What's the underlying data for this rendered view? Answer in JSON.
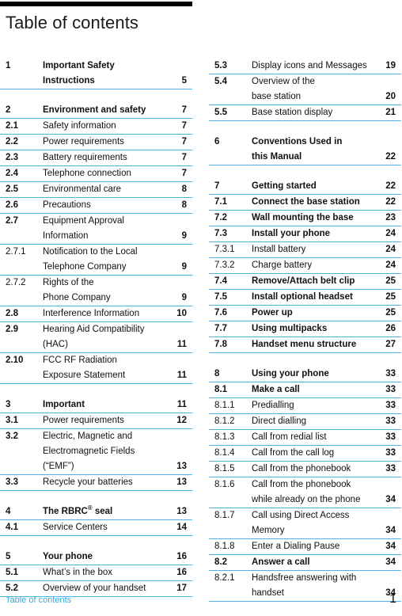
{
  "document": {
    "title": "Table of contents",
    "footer_label": "Table of contents",
    "footer_page": "1",
    "rule_color": "#4FB3E8",
    "accent_color": "#36A9E1",
    "bar_color": "#000000"
  },
  "columns": [
    {
      "groups": [
        {
          "rows": [
            {
              "num": "1",
              "lines": [
                "Important Safety",
                "Instructions"
              ],
              "page": "5",
              "level": 1,
              "bold_num": true,
              "bold_title": true,
              "bold_page": true
            }
          ]
        },
        {
          "rows": [
            {
              "num": "2",
              "lines": [
                "Environment and safety"
              ],
              "page": "7",
              "level": 1,
              "bold_num": true,
              "bold_title": true,
              "bold_page": true
            },
            {
              "num": "2.1",
              "lines": [
                "Safety information"
              ],
              "page": "7",
              "level": 2,
              "bold_num": true,
              "bold_title": false,
              "bold_page": true
            },
            {
              "num": "2.2",
              "lines": [
                "Power requirements"
              ],
              "page": "7",
              "level": 2,
              "bold_num": true,
              "bold_title": false,
              "bold_page": true
            },
            {
              "num": "2.3",
              "lines": [
                "Battery requirements"
              ],
              "page": "7",
              "level": 2,
              "bold_num": true,
              "bold_title": false,
              "bold_page": true
            },
            {
              "num": "2.4",
              "lines": [
                "Telephone connection"
              ],
              "page": "7",
              "level": 2,
              "bold_num": true,
              "bold_title": false,
              "bold_page": true
            },
            {
              "num": "2.5",
              "lines": [
                "Environmental care"
              ],
              "page": "8",
              "level": 2,
              "bold_num": true,
              "bold_title": false,
              "bold_page": true
            },
            {
              "num": "2.6",
              "lines": [
                "Precautions"
              ],
              "page": "8",
              "level": 2,
              "bold_num": true,
              "bold_title": false,
              "bold_page": true
            },
            {
              "num": "2.7",
              "lines": [
                "Equipment Approval",
                "Information"
              ],
              "page": "9",
              "level": 2,
              "bold_num": true,
              "bold_title": false,
              "bold_page": true
            },
            {
              "num": "2.7.1",
              "lines": [
                "Notification to the Local",
                "Telephone Company"
              ],
              "page": "9",
              "level": 3,
              "bold_num": false,
              "bold_title": false,
              "bold_page": true
            },
            {
              "num": "2.7.2",
              "lines": [
                "Rights of the",
                "Phone Company"
              ],
              "page": "9",
              "level": 3,
              "bold_num": false,
              "bold_title": false,
              "bold_page": true
            },
            {
              "num": "2.8",
              "lines": [
                "Interference Information"
              ],
              "page": "10",
              "level": 2,
              "bold_num": true,
              "bold_title": false,
              "bold_page": true
            },
            {
              "num": "2.9",
              "lines": [
                "Hearing Aid Compatibility",
                "(HAC)"
              ],
              "page": "11",
              "level": 2,
              "bold_num": true,
              "bold_title": false,
              "bold_page": true
            },
            {
              "num": "2.10",
              "lines": [
                "FCC RF Radiation",
                "Exposure Statement"
              ],
              "page": "11",
              "level": 2,
              "bold_num": true,
              "bold_title": false,
              "bold_page": true
            }
          ]
        },
        {
          "rows": [
            {
              "num": "3",
              "lines": [
                "Important"
              ],
              "page": "11",
              "level": 1,
              "bold_num": true,
              "bold_title": true,
              "bold_page": true
            },
            {
              "num": "3.1",
              "lines": [
                "Power requirements"
              ],
              "page": "12",
              "level": 2,
              "bold_num": true,
              "bold_title": false,
              "bold_page": true
            },
            {
              "num": "3.2",
              "lines": [
                "Electric, Magnetic and",
                "Electromagnetic Fields",
                "(“EMF”)"
              ],
              "page": "13",
              "level": 2,
              "bold_num": true,
              "bold_title": false,
              "bold_page": true
            },
            {
              "num": "3.3",
              "lines": [
                "Recycle your batteries"
              ],
              "page": "13",
              "level": 2,
              "bold_num": true,
              "bold_title": false,
              "bold_page": true
            }
          ]
        },
        {
          "rows": [
            {
              "num": "4",
              "lines": [
                "The RBRC® seal"
              ],
              "page": "13",
              "level": 1,
              "bold_num": true,
              "bold_title": true,
              "bold_page": true,
              "html_title": true
            },
            {
              "num": "4.1",
              "lines": [
                "Service Centers"
              ],
              "page": "14",
              "level": 2,
              "bold_num": true,
              "bold_title": false,
              "bold_page": true
            }
          ]
        },
        {
          "rows": [
            {
              "num": "5",
              "lines": [
                "Your phone"
              ],
              "page": "16",
              "level": 1,
              "bold_num": true,
              "bold_title": true,
              "bold_page": true
            },
            {
              "num": "5.1",
              "lines": [
                "What’s in the box"
              ],
              "page": "16",
              "level": 2,
              "bold_num": true,
              "bold_title": false,
              "bold_page": true
            },
            {
              "num": "5.2",
              "lines": [
                "Overview of your handset"
              ],
              "page": "17",
              "level": 2,
              "bold_num": true,
              "bold_title": false,
              "bold_page": true
            }
          ]
        }
      ]
    },
    {
      "groups": [
        {
          "rows": [
            {
              "num": "5.3",
              "lines": [
                "Display icons and Messages"
              ],
              "page": "19",
              "level": 2,
              "bold_num": true,
              "bold_title": false,
              "bold_page": true
            },
            {
              "num": "5.4",
              "lines": [
                "Overview of the",
                "base station"
              ],
              "page": "20",
              "level": 2,
              "bold_num": true,
              "bold_title": false,
              "bold_page": true
            },
            {
              "num": "5.5",
              "lines": [
                "Base station display"
              ],
              "page": "21",
              "level": 2,
              "bold_num": true,
              "bold_title": false,
              "bold_page": true
            }
          ]
        },
        {
          "rows": [
            {
              "num": "6",
              "lines": [
                "Conventions Used in",
                "this Manual"
              ],
              "page": "22",
              "level": 1,
              "bold_num": true,
              "bold_title": true,
              "bold_page": true
            }
          ]
        },
        {
          "rows": [
            {
              "num": "7",
              "lines": [
                "Getting started"
              ],
              "page": "22",
              "level": 1,
              "bold_num": true,
              "bold_title": true,
              "bold_page": true
            },
            {
              "num": "7.1",
              "lines": [
                "Connect the base station"
              ],
              "page": "22",
              "level": 2,
              "bold_num": true,
              "bold_title": true,
              "bold_page": true
            },
            {
              "num": "7.2",
              "lines": [
                "Wall mounting the base"
              ],
              "page": "23",
              "level": 2,
              "bold_num": true,
              "bold_title": true,
              "bold_page": true
            },
            {
              "num": "7.3",
              "lines": [
                "Install your phone"
              ],
              "page": "24",
              "level": 2,
              "bold_num": true,
              "bold_title": true,
              "bold_page": true
            },
            {
              "num": "7.3.1",
              "lines": [
                "Install battery"
              ],
              "page": "24",
              "level": 3,
              "bold_num": false,
              "bold_title": false,
              "bold_page": true
            },
            {
              "num": "7.3.2",
              "lines": [
                "Charge battery"
              ],
              "page": "24",
              "level": 3,
              "bold_num": false,
              "bold_title": false,
              "bold_page": true
            },
            {
              "num": "7.4",
              "lines": [
                "Remove/Attach belt clip"
              ],
              "page": "25",
              "level": 2,
              "bold_num": true,
              "bold_title": true,
              "bold_page": true
            },
            {
              "num": "7.5",
              "lines": [
                "Install optional headset"
              ],
              "page": "25",
              "level": 2,
              "bold_num": true,
              "bold_title": true,
              "bold_page": true
            },
            {
              "num": "7.6",
              "lines": [
                "Power up"
              ],
              "page": "25",
              "level": 2,
              "bold_num": true,
              "bold_title": true,
              "bold_page": true
            },
            {
              "num": "7.7",
              "lines": [
                "Using multipacks"
              ],
              "page": "26",
              "level": 2,
              "bold_num": true,
              "bold_title": true,
              "bold_page": true
            },
            {
              "num": "7.8",
              "lines": [
                "Handset menu structure"
              ],
              "page": "27",
              "level": 2,
              "bold_num": true,
              "bold_title": true,
              "bold_page": true
            }
          ]
        },
        {
          "rows": [
            {
              "num": "8",
              "lines": [
                "Using your phone"
              ],
              "page": "33",
              "level": 1,
              "bold_num": true,
              "bold_title": true,
              "bold_page": true
            },
            {
              "num": "8.1",
              "lines": [
                "Make a call"
              ],
              "page": "33",
              "level": 2,
              "bold_num": true,
              "bold_title": true,
              "bold_page": true
            },
            {
              "num": "8.1.1",
              "lines": [
                "Predialling"
              ],
              "page": "33",
              "level": 3,
              "bold_num": false,
              "bold_title": false,
              "bold_page": true
            },
            {
              "num": "8.1.2",
              "lines": [
                "Direct dialling"
              ],
              "page": "33",
              "level": 3,
              "bold_num": false,
              "bold_title": false,
              "bold_page": true
            },
            {
              "num": "8.1.3",
              "lines": [
                "Call from redial list"
              ],
              "page": "33",
              "level": 3,
              "bold_num": false,
              "bold_title": false,
              "bold_page": true
            },
            {
              "num": "8.1.4",
              "lines": [
                "Call from the call log"
              ],
              "page": "33",
              "level": 3,
              "bold_num": false,
              "bold_title": false,
              "bold_page": true
            },
            {
              "num": "8.1.5",
              "lines": [
                "Call from the phonebook"
              ],
              "page": "33",
              "level": 3,
              "bold_num": false,
              "bold_title": false,
              "bold_page": true
            },
            {
              "num": "8.1.6",
              "lines": [
                "Call from the phonebook",
                "while already on the phone"
              ],
              "page": "34",
              "level": 3,
              "bold_num": false,
              "bold_title": false,
              "bold_page": true
            },
            {
              "num": "8.1.7",
              "lines": [
                "Call using Direct Access",
                "Memory"
              ],
              "page": "34",
              "level": 3,
              "bold_num": false,
              "bold_title": false,
              "bold_page": true
            },
            {
              "num": "8.1.8",
              "lines": [
                "Enter a Dialing Pause"
              ],
              "page": "34",
              "level": 3,
              "bold_num": false,
              "bold_title": false,
              "bold_page": true
            },
            {
              "num": "8.2",
              "lines": [
                "Answer a call"
              ],
              "page": "34",
              "level": 2,
              "bold_num": true,
              "bold_title": true,
              "bold_page": true
            },
            {
              "num": "8.2.1",
              "lines": [
                "Handsfree answering with",
                "handset"
              ],
              "page": "34",
              "level": 3,
              "bold_num": false,
              "bold_title": false,
              "bold_page": true
            }
          ]
        }
      ]
    }
  ]
}
